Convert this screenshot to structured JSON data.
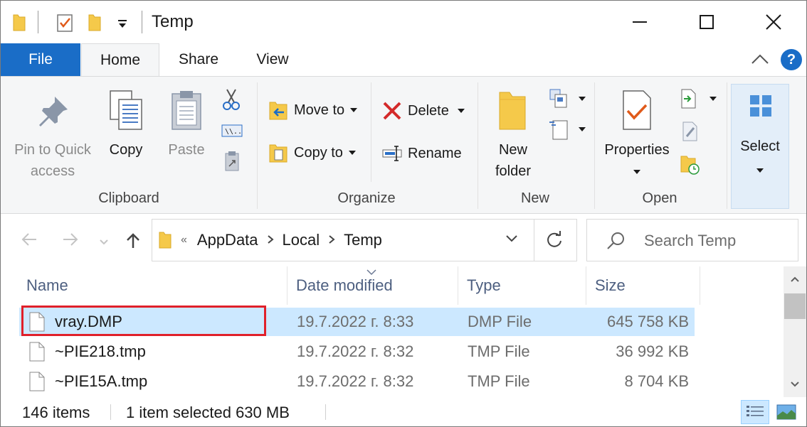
{
  "window": {
    "title": "Temp"
  },
  "ribbon_tabs": {
    "file": "File",
    "home": "Home",
    "share": "Share",
    "view": "View",
    "help": "?"
  },
  "ribbon": {
    "clipboard": {
      "group_label": "Clipboard",
      "pin_line1": "Pin to Quick",
      "pin_line2": "access",
      "copy": "Copy",
      "paste": "Paste"
    },
    "organize": {
      "group_label": "Organize",
      "move_to": "Move to",
      "copy_to": "Copy to",
      "delete": "Delete",
      "rename": "Rename"
    },
    "new": {
      "group_label": "New",
      "new_folder_line1": "New",
      "new_folder_line2": "folder"
    },
    "open": {
      "group_label": "Open",
      "properties": "Properties"
    },
    "select": {
      "label": "Select"
    }
  },
  "address": {
    "overflow": "«",
    "crumbs": [
      "AppData",
      "Local",
      "Temp"
    ]
  },
  "search": {
    "placeholder": "Search Temp"
  },
  "columns": {
    "name": "Name",
    "date": "Date modified",
    "type": "Type",
    "size": "Size"
  },
  "files": [
    {
      "name": "vray.DMP",
      "date": "19.7.2022 г. 8:33",
      "type": "DMP File",
      "size": "645 758 KB",
      "selected": true
    },
    {
      "name": "~PIE218.tmp",
      "date": "19.7.2022 г. 8:32",
      "type": "TMP File",
      "size": "36 992 KB",
      "selected": false
    },
    {
      "name": "~PIE15A.tmp",
      "date": "19.7.2022 г. 8:32",
      "type": "TMP File",
      "size": "8 704 KB",
      "selected": false
    }
  ],
  "status": {
    "items": "146 items",
    "selected": "1 item selected  630 MB"
  },
  "colors": {
    "accent": "#1a6dc7",
    "selection": "#cce8ff",
    "highlight_box": "#e0202a",
    "folder": "#f5c94a"
  }
}
